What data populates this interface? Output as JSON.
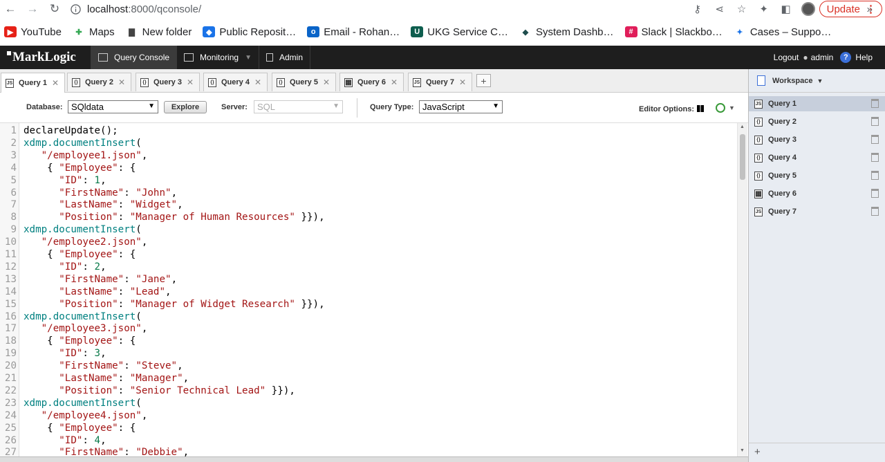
{
  "browser": {
    "url_host": "localhost",
    "url_path": ":8000/qconsole/",
    "update_label": "Update",
    "bookmarks": [
      {
        "label": "YouTube",
        "icon": "youtube-icon",
        "color": "#e62117"
      },
      {
        "label": "Maps",
        "icon": "maps-icon",
        "color": "#34a853"
      },
      {
        "label": "New folder",
        "icon": "folder-icon",
        "color": "#444444"
      },
      {
        "label": "Public Reposit…",
        "icon": "shield-icon",
        "color": "#1a73e8"
      },
      {
        "label": "Email - Rohan…",
        "icon": "outlook-icon",
        "color": "#0a64c8"
      },
      {
        "label": "UKG Service C…",
        "icon": "ukg-icon",
        "color": "#0e5e4e"
      },
      {
        "label": "System Dashb…",
        "icon": "diamond-icon",
        "color": "#1f4d4d"
      },
      {
        "label": "Slack | Slackbo…",
        "icon": "slack-icon",
        "color": "#e01e5a"
      },
      {
        "label": "Cases – Suppo…",
        "icon": "person-icon",
        "color": "#1a73e8"
      }
    ],
    "more_label": "»"
  },
  "nav": {
    "logo": "MarkLogic",
    "tabs": [
      {
        "label": "Query Console",
        "active": true
      },
      {
        "label": "Monitoring",
        "active": false
      },
      {
        "label": "Admin",
        "active": false
      }
    ],
    "logout": "Logout",
    "user": "admin",
    "help": "Help"
  },
  "query_tabs": [
    {
      "label": "Query 1",
      "icon": "JS",
      "active": true
    },
    {
      "label": "Query 2",
      "icon": "{}",
      "active": false
    },
    {
      "label": "Query 3",
      "icon": "{}",
      "active": false
    },
    {
      "label": "Query 4",
      "icon": "{}",
      "active": false
    },
    {
      "label": "Query 5",
      "icon": "{}",
      "active": false
    },
    {
      "label": "Query 6",
      "icon": "grid",
      "active": false
    },
    {
      "label": "Query 7",
      "icon": "JS",
      "active": false
    }
  ],
  "toolbar": {
    "database_label": "Database:",
    "database_value": "SQldata",
    "explore_label": "Explore",
    "server_label": "Server:",
    "server_value": "SQL",
    "query_type_label": "Query Type:",
    "query_type_value": "JavaScript",
    "editor_options_label": "Editor Options:"
  },
  "code_lines": [
    "declareUpdate();",
    "xdmp.documentInsert(",
    "   \"/employee1.json\",",
    "    { \"Employee\": {",
    "      \"ID\": 1,",
    "      \"FirstName\": \"John\",",
    "      \"LastName\": \"Widget\",",
    "      \"Position\": \"Manager of Human Resources\" }}),",
    "xdmp.documentInsert(",
    "   \"/employee2.json\",",
    "    { \"Employee\": {",
    "      \"ID\": 2,",
    "      \"FirstName\": \"Jane\",",
    "      \"LastName\": \"Lead\",",
    "      \"Position\": \"Manager of Widget Research\" }}),",
    "xdmp.documentInsert(",
    "   \"/employee3.json\",",
    "    { \"Employee\": {",
    "      \"ID\": 3,",
    "      \"FirstName\": \"Steve\",",
    "      \"LastName\": \"Manager\",",
    "      \"Position\": \"Senior Technical Lead\" }}),",
    "xdmp.documentInsert(",
    "   \"/employee4.json\",",
    "    { \"Employee\": {",
    "      \"ID\": 4,",
    "      \"FirstName\": \"Debbie\","
  ],
  "workspace": {
    "title": "Workspace",
    "items": [
      {
        "label": "Query 1",
        "icon": "JS",
        "active": true
      },
      {
        "label": "Query 2",
        "icon": "{}",
        "active": false
      },
      {
        "label": "Query 3",
        "icon": "{}",
        "active": false
      },
      {
        "label": "Query 4",
        "icon": "{}",
        "active": false
      },
      {
        "label": "Query 5",
        "icon": "{}",
        "active": false
      },
      {
        "label": "Query 6",
        "icon": "grid",
        "active": false
      },
      {
        "label": "Query 7",
        "icon": "JS",
        "active": false
      }
    ],
    "add_label": "+"
  }
}
